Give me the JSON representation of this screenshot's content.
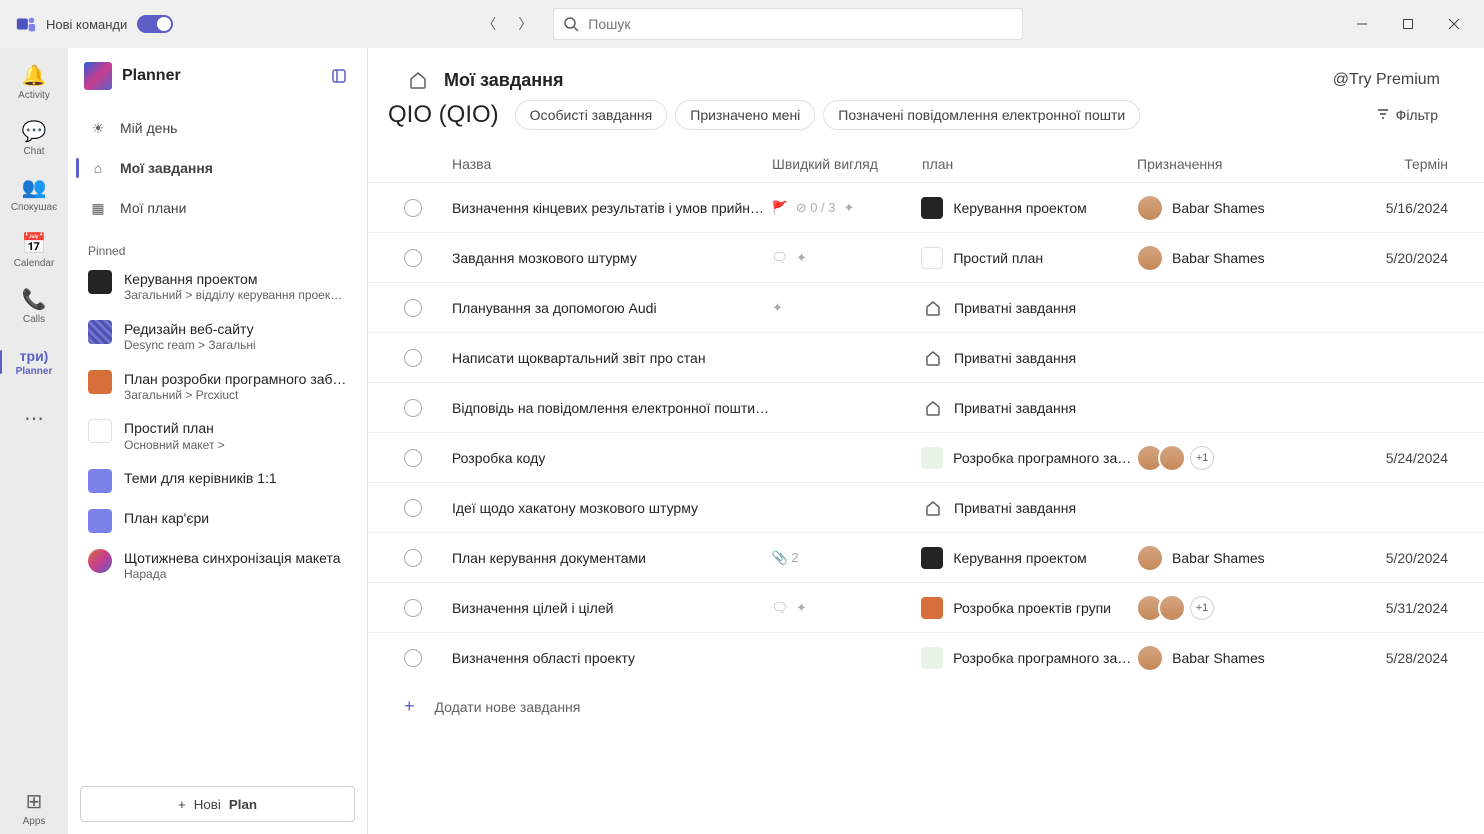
{
  "titlebar": {
    "brand": "Нові команди"
  },
  "search": {
    "placeholder": "Пошук"
  },
  "rail": {
    "activity": "Activity",
    "chat": "Chat",
    "teams": "Спокушає",
    "calendar": "Calendar",
    "calls": "Calls",
    "planner_pre": "три)",
    "planner": "Planner",
    "apps": "Apps"
  },
  "sidebar": {
    "app_title": "Planner",
    "nav": {
      "my_day": "Мій день",
      "my_tasks": "Мої завдання",
      "my_plans": "Мої плани"
    },
    "pinned_label": "Pinned",
    "pins": [
      {
        "title": "Керування проектом",
        "sub": "Загальний &gt; відділу керування проектами"
      },
      {
        "title": "Редизайн веб-сайту",
        "sub": "Desync ream > Загальні"
      },
      {
        "title": "План розробки програмного забезпечення",
        "sub": "Загальний &gt; Prcxiuct"
      },
      {
        "title": "Простий план",
        "sub": "Основний макет &gt;"
      },
      {
        "title": "Теми для керівників 1:1",
        "sub": ""
      },
      {
        "title": "План кар'єри",
        "sub": ""
      },
      {
        "title": "Щотижнева синхронізація макета",
        "sub": "Нарада"
      }
    ],
    "new_plan_pre": "Нові",
    "new_plan": "Plan"
  },
  "header": {
    "title": "Мої завдання",
    "premium": "@Try Premium",
    "crumb": "QIO (QIO)",
    "tabs": {
      "private": "Особисті завдання",
      "assigned": "Призначено мені",
      "flagged": "Позначені повідомлення електронної пошти"
    },
    "filter": "Фільтр"
  },
  "columns": {
    "name": "Назва",
    "quick": "Швидкий вигляд",
    "plan": "план",
    "assign": "Призначення",
    "due": "Термін"
  },
  "tasks": [
    {
      "name": "Визначення кінцевих результатів і умов прийняття",
      "quick": "0 / 3",
      "plan": "Керування проектом",
      "plan_class": "dark",
      "assignee": "Babar Shames",
      "due": "5/16/2024",
      "avatars": 1
    },
    {
      "name": "Завдання мозкового штурму",
      "quick": "note",
      "plan": "Простий план",
      "plan_class": "rb",
      "assignee": "Babar Shames",
      "due": "5/20/2024",
      "avatars": 1
    },
    {
      "name": "Планування за допомогою Audi",
      "quick": "spark",
      "plan": "Приватні завдання",
      "plan_class": "home",
      "assignee": "",
      "due": "",
      "avatars": 0
    },
    {
      "name": "Написати щоквартальний звіт про стан",
      "quick": "",
      "plan": "Приватні завдання",
      "plan_class": "home",
      "assignee": "",
      "due": "",
      "avatars": 0
    },
    {
      "name": "Відповідь на повідомлення електронної пошти від Алекса",
      "quick": "",
      "plan": "Приватні завдання",
      "plan_class": "home",
      "assignee": "",
      "due": "",
      "avatars": 0
    },
    {
      "name": "Розробка коду",
      "quick": "",
      "plan": "Розробка програмного забезпечення",
      "plan_class": "green",
      "assignee": "",
      "due": "5/24/2024",
      "avatars": 2,
      "extra": "+1"
    },
    {
      "name": "Ідеї щодо хакатону мозкового штурму",
      "quick": "",
      "plan": "Приватні завдання",
      "plan_class": "home",
      "assignee": "",
      "due": "",
      "avatars": 0
    },
    {
      "name": "План керування документами",
      "quick": "attach",
      "attach_count": "2",
      "plan": "Керування проектом",
      "plan_class": "dark",
      "assignee": "Babar Shames",
      "due": "5/20/2024",
      "avatars": 1
    },
    {
      "name": "Визначення цілей і цілей",
      "quick": "note",
      "plan": "Розробка проектів групи",
      "plan_class": "orange",
      "assignee": "",
      "due": "5/31/2024",
      "avatars": 2,
      "extra": "+1"
    },
    {
      "name": "Визначення області проекту",
      "quick": "",
      "plan": "Розробка програмного забезпечення",
      "plan_class": "green",
      "assignee": "Babar Shames",
      "due": "5/28/2024",
      "avatars": 1
    }
  ],
  "add_task": "Додати нове завдання"
}
